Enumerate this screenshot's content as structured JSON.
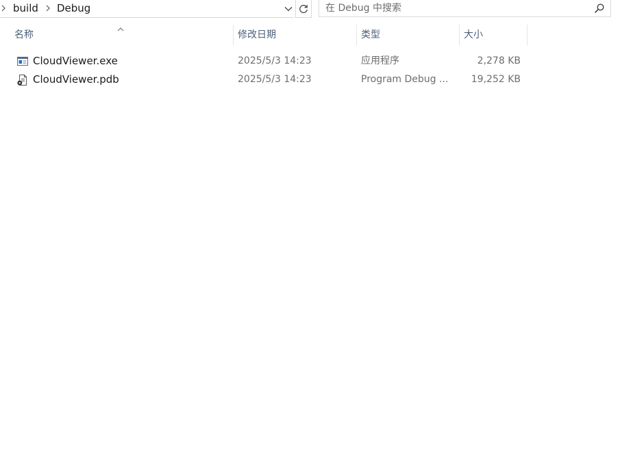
{
  "address_bar": {
    "crumbs": [
      "build",
      "Debug"
    ]
  },
  "search": {
    "placeholder": "在 Debug 中搜索",
    "value": ""
  },
  "columns": {
    "name": "名称",
    "date": "修改日期",
    "type": "类型",
    "size": "大小",
    "sort_column": "name",
    "sort_direction": "ascending"
  },
  "files": [
    {
      "name": "CloudViewer.exe",
      "date": "2025/5/3 14:23",
      "type": "应用程序",
      "size": "2,278 KB",
      "icon": "application-exe-icon"
    },
    {
      "name": "CloudViewer.pdb",
      "date": "2025/5/3 14:23",
      "type": "Program Debug ...",
      "size": "19,252 KB",
      "icon": "debug-database-file-icon"
    }
  ],
  "colors": {
    "header_text": "#4c607a",
    "secondary_text": "#6d6d6d",
    "exe_icon_accent": "#1f6fc5"
  }
}
